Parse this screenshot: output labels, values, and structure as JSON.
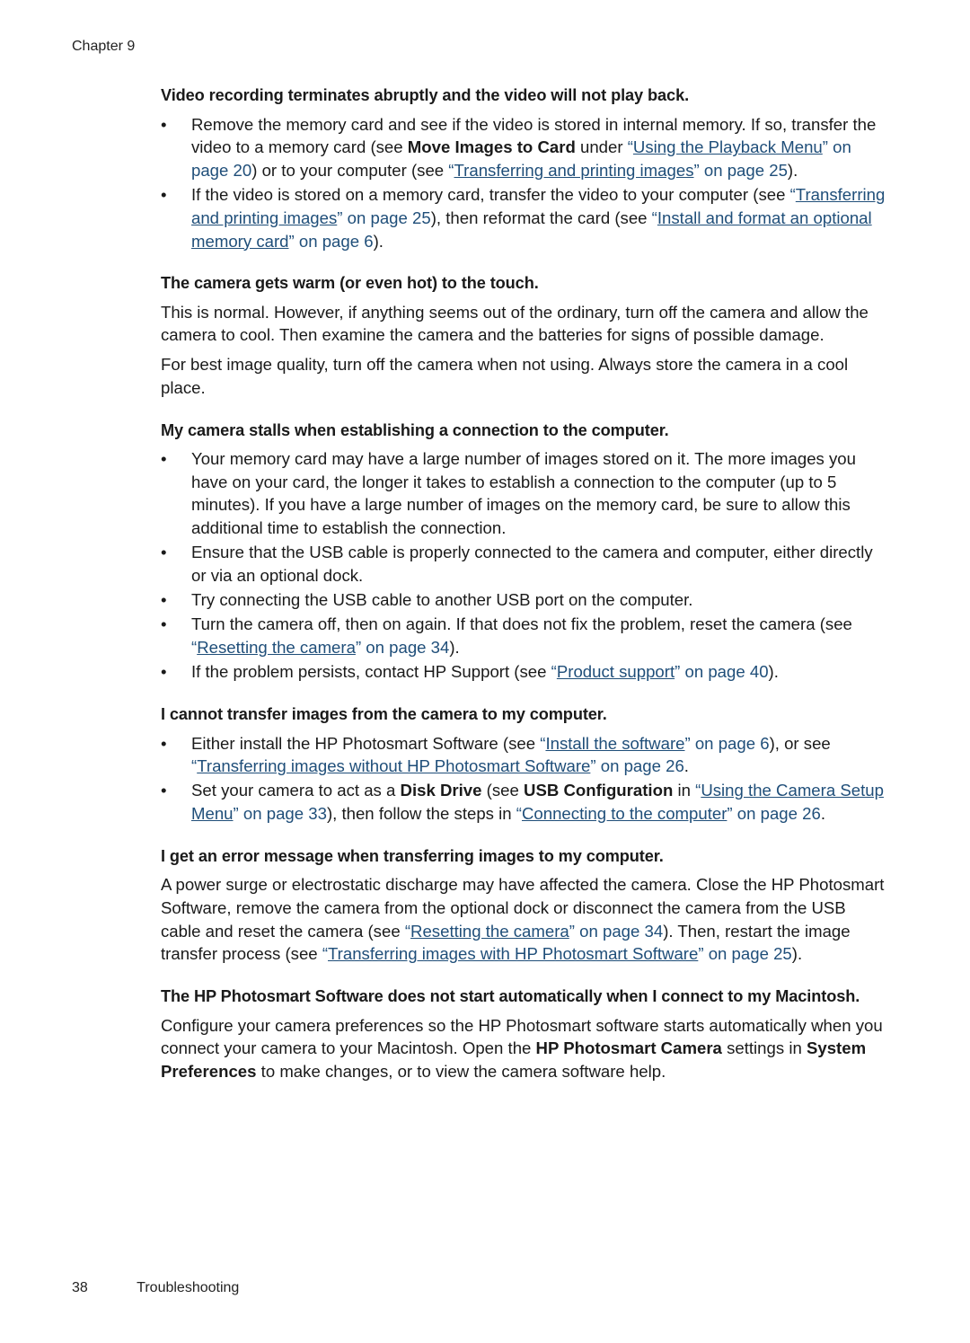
{
  "header": {
    "chapter": "Chapter 9"
  },
  "footer": {
    "page_number": "38",
    "section": "Troubleshooting"
  },
  "colors": {
    "link": "#1f4e79",
    "text": "#1a1a1a"
  },
  "sections": [
    {
      "heading": "Video recording terminates abruptly and the video will not play back.",
      "bullets": [
        [
          {
            "t": "Remove the memory card and see if the video is stored in internal memory. If so, transfer the video to a memory card (see "
          },
          {
            "b": "Move Images to Card"
          },
          {
            "t": " under "
          },
          {
            "link": "Using the Playback Menu",
            "page": "on page 20"
          },
          {
            "t": ") or to your computer (see "
          },
          {
            "link": "Transferring and printing images",
            "page": "on page 25"
          },
          {
            "t": ")."
          }
        ],
        [
          {
            "t": "If the video is stored on a memory card, transfer the video to your computer (see "
          },
          {
            "link": "Transferring and printing images",
            "page": "on page 25"
          },
          {
            "t": "), then reformat the card (see "
          },
          {
            "link": "Install and format an optional memory card",
            "page": "on page 6"
          },
          {
            "t": ")."
          }
        ]
      ]
    },
    {
      "heading": "The camera gets warm (or even hot) to the touch.",
      "paragraphs": [
        [
          {
            "t": "This is normal. However, if anything seems out of the ordinary, turn off the camera and allow the camera to cool. Then examine the camera and the batteries for signs of possible damage."
          }
        ],
        [
          {
            "t": "For best image quality, turn off the camera when not using. Always store the camera in a cool place."
          }
        ]
      ]
    },
    {
      "heading": "My camera stalls when establishing a connection to the computer.",
      "bullets": [
        [
          {
            "t": "Your memory card may have a large number of images stored on it. The more images you have on your card, the longer it takes to establish a connection to the computer (up to 5 minutes). If you have a large number of images on the memory card, be sure to allow this additional time to establish the connection."
          }
        ],
        [
          {
            "t": "Ensure that the USB cable is properly connected to the camera and computer, either directly or via an optional dock."
          }
        ],
        [
          {
            "t": "Try connecting the USB cable to another USB port on the computer."
          }
        ],
        [
          {
            "t": "Turn the camera off, then on again. If that does not fix the problem, reset the camera (see "
          },
          {
            "link": "Resetting the camera",
            "page": "on page 34"
          },
          {
            "t": ")."
          }
        ],
        [
          {
            "t": "If the problem persists, contact HP Support (see "
          },
          {
            "link": "Product support",
            "page": "on page 40"
          },
          {
            "t": ")."
          }
        ]
      ]
    },
    {
      "heading": "I cannot transfer images from the camera to my computer.",
      "bullets": [
        [
          {
            "t": "Either install the HP Photosmart Software (see "
          },
          {
            "link": "Install the software",
            "page": "on page 6"
          },
          {
            "t": "), or see "
          },
          {
            "link": "Transferring images without HP Photosmart Software",
            "page": "on page 26"
          },
          {
            "t": "."
          }
        ],
        [
          {
            "t": "Set your camera to act as a "
          },
          {
            "b": "Disk Drive"
          },
          {
            "t": " (see "
          },
          {
            "b": "USB Configuration"
          },
          {
            "t": " in "
          },
          {
            "link": "Using the Camera Setup Menu",
            "page": "on page 33"
          },
          {
            "t": "), then follow the steps in "
          },
          {
            "link": "Connecting to the computer",
            "page": "on page 26"
          },
          {
            "t": "."
          }
        ]
      ]
    },
    {
      "heading": "I get an error message when transferring images to my computer.",
      "paragraphs": [
        [
          {
            "t": "A power surge or electrostatic discharge may have affected the camera. Close the HP Photosmart Software, remove the camera from the optional dock or disconnect the camera from the USB cable and reset the camera (see "
          },
          {
            "link": "Resetting the camera",
            "page": "on page 34"
          },
          {
            "t": "). Then, restart the image transfer process (see "
          },
          {
            "link": "Transferring images with HP Photosmart Software",
            "page": "on page 25"
          },
          {
            "t": ")."
          }
        ]
      ]
    },
    {
      "heading": "The HP Photosmart Software does not start automatically when I connect to my Macintosh.",
      "paragraphs": [
        [
          {
            "t": "Configure your camera preferences so the HP Photosmart software starts automatically when you connect your camera to your Macintosh. Open the "
          },
          {
            "b": "HP Photosmart Camera"
          },
          {
            "t": " settings in "
          },
          {
            "b": "System Preferences"
          },
          {
            "t": " to make changes, or to view the camera software help."
          }
        ]
      ]
    }
  ]
}
